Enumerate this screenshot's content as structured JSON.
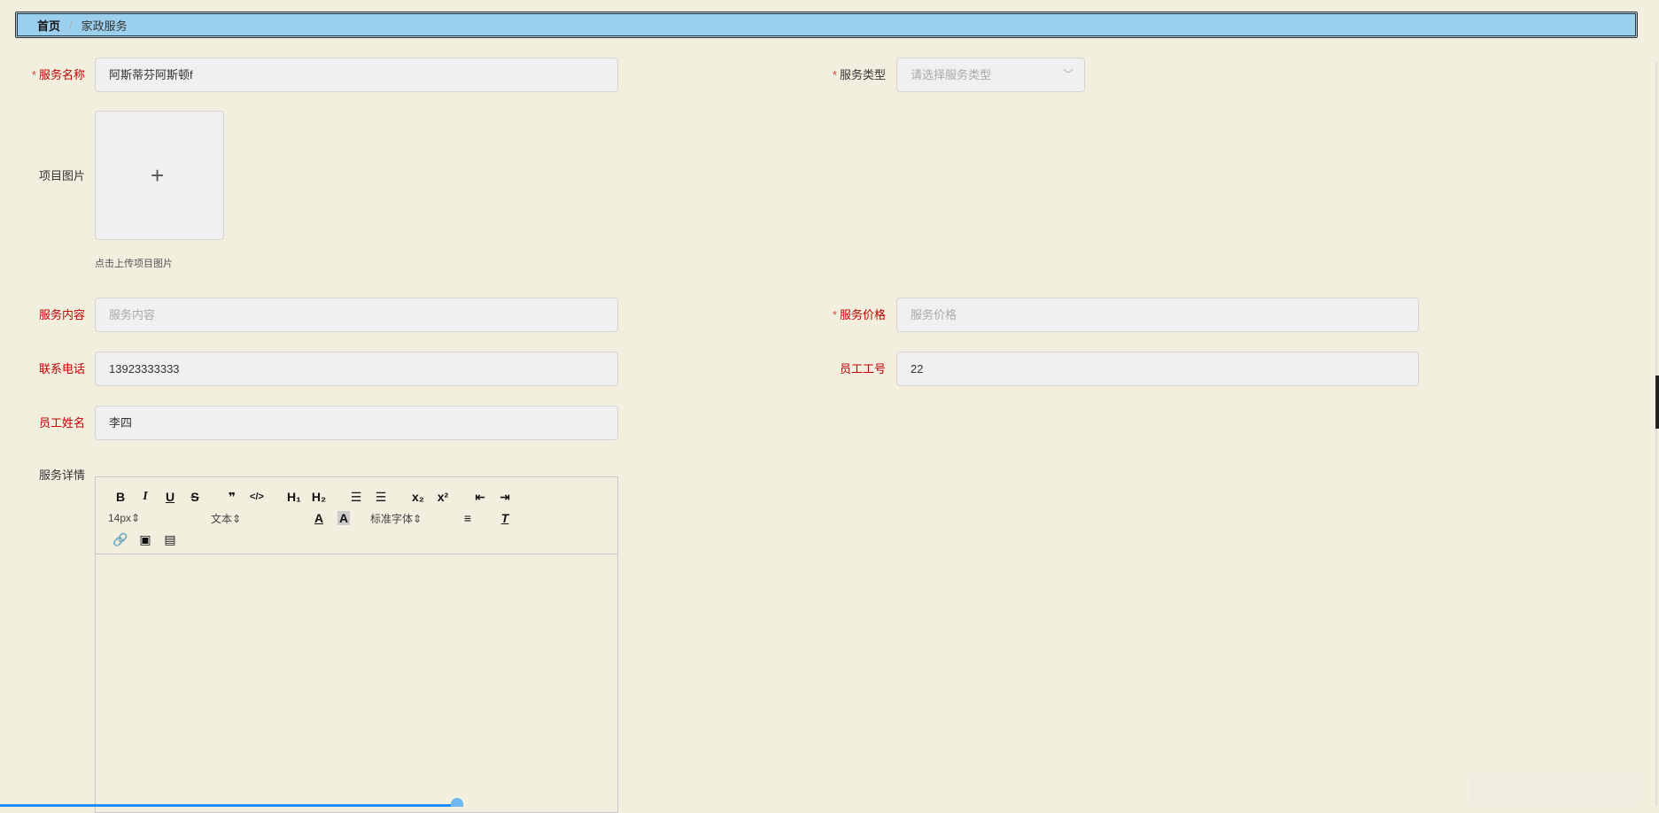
{
  "breadcrumb": {
    "home": "首页",
    "separator": "/",
    "current": "家政服务"
  },
  "form": {
    "service_name": {
      "label": "服务名称",
      "required": true,
      "value": "阿斯蒂芬阿斯顿f"
    },
    "service_type": {
      "label": "服务类型",
      "required": true,
      "placeholder": "请选择服务类型"
    },
    "project_image": {
      "label": "项目图片",
      "hint": "点击上传项目图片"
    },
    "service_content": {
      "label": "服务内容",
      "placeholder": "服务内容"
    },
    "service_price": {
      "label": "服务价格",
      "required": true,
      "placeholder": "服务价格"
    },
    "phone": {
      "label": "联系电话",
      "value": "13923333333"
    },
    "employee_id": {
      "label": "员工工号",
      "value": "22"
    },
    "employee_name": {
      "label": "员工姓名",
      "value": "李四"
    },
    "details": {
      "label": "服务详情"
    }
  },
  "editor": {
    "size": "14px",
    "header": "文本",
    "font": "标准字体",
    "required_star": "*"
  }
}
